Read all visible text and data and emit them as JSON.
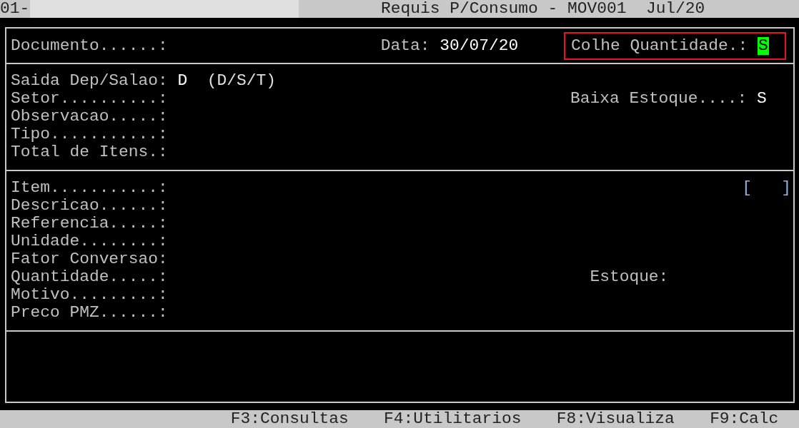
{
  "title_bar": {
    "left": "01-",
    "title": "Requis P/Consumo - MOV001  Jul/20"
  },
  "header": {
    "documento_label": "Documento......:",
    "data_label": "Data:",
    "data_value": "30/07/20",
    "colhe_label": "Colhe Quantidade.:",
    "colhe_value": "S",
    "highlighted": true,
    "cursor": true
  },
  "section_1": [
    {
      "label": "Saida Dep/Salao:",
      "value": "D",
      "hint": "(D/S/T)"
    },
    {
      "label": "Setor..........:",
      "side_label": "Baixa Estoque....:",
      "side_value": "S"
    },
    {
      "label": "Observacao.....:"
    },
    {
      "label": "Tipo...........:"
    },
    {
      "label": "Total de Itens.:"
    }
  ],
  "section_2": [
    {
      "label": "Item...........:",
      "field": "[   ]"
    },
    {
      "label": "Descricao......:"
    },
    {
      "label": "Referencia.....:"
    },
    {
      "label": "Unidade........:"
    },
    {
      "label": "Fator Conversao:"
    },
    {
      "label": "Quantidade.....:",
      "side_label": "Estoque:"
    },
    {
      "label": "Motivo.........:"
    },
    {
      "label": "Preco PMZ......:"
    }
  ],
  "function_keys": [
    "F3:Consultas",
    "F4:Utilitarios",
    "F8:Visualiza",
    "F9:Calc"
  ]
}
